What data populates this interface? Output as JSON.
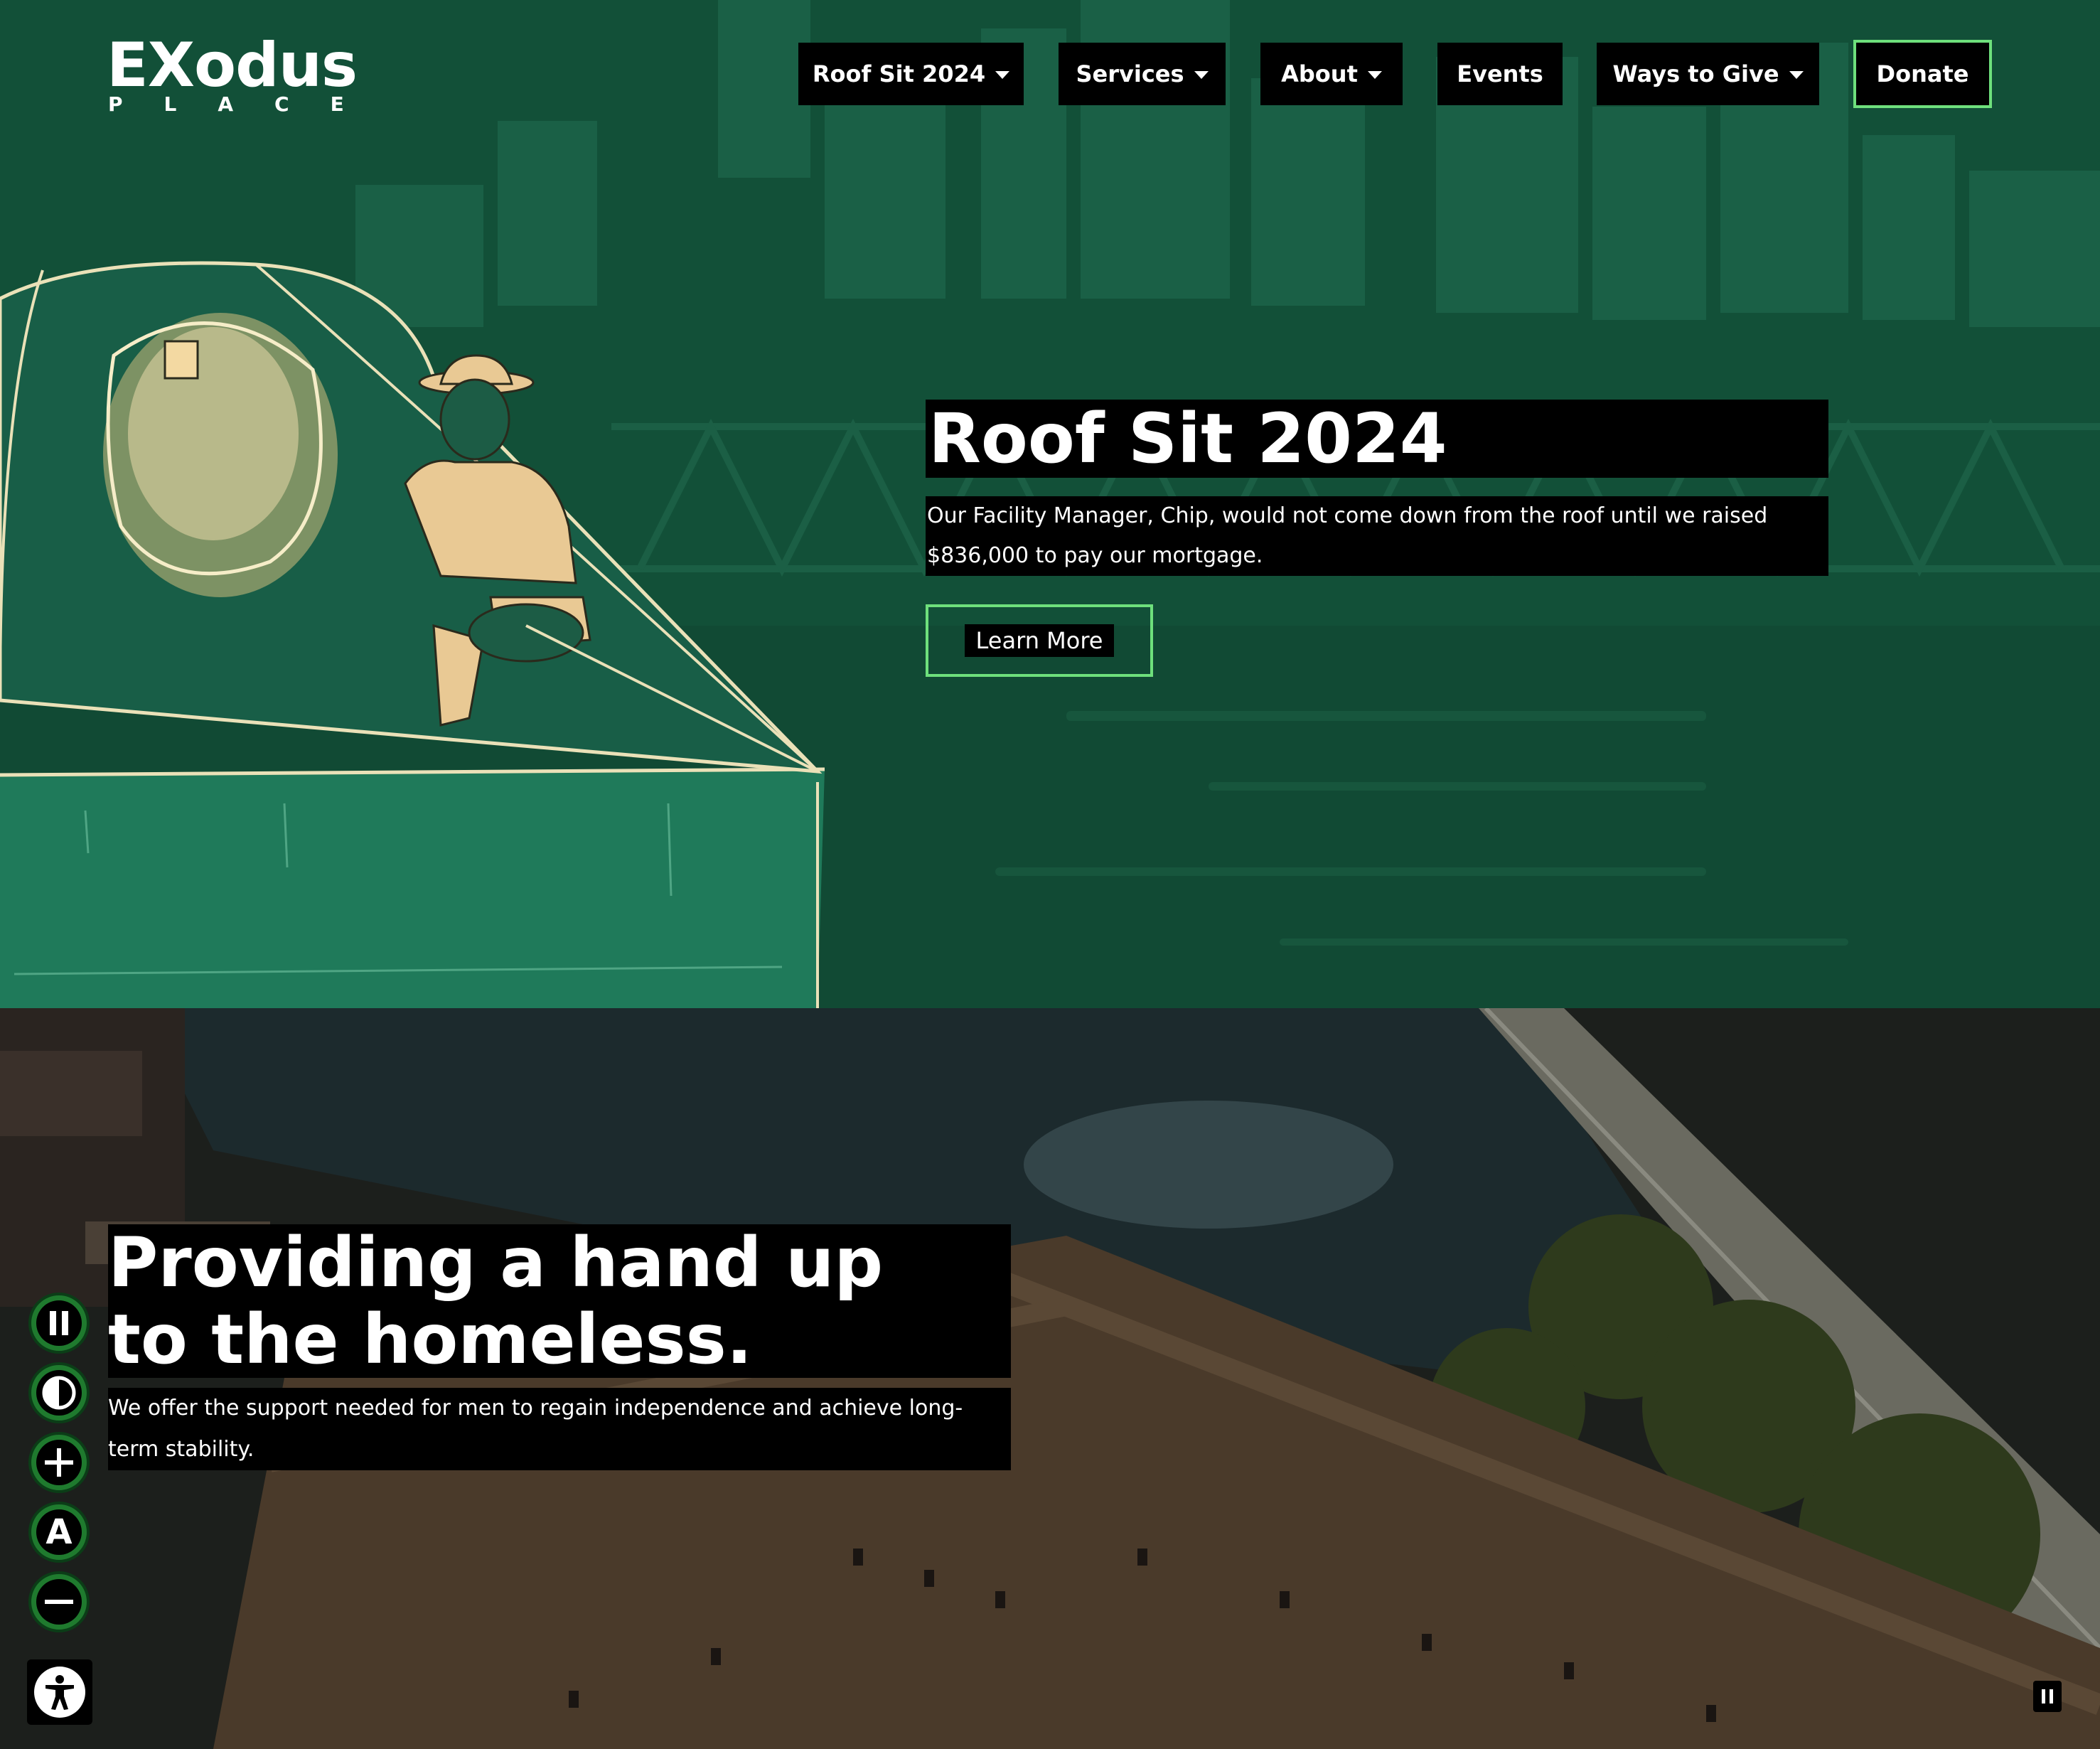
{
  "header": {
    "logo": {
      "word": "EXodus",
      "sub": "PLACE"
    },
    "nav": [
      {
        "label": "Roof Sit 2024",
        "dropdown": true
      },
      {
        "label": "Services",
        "dropdown": true
      },
      {
        "label": "About",
        "dropdown": true
      },
      {
        "label": "Events",
        "dropdown": false
      },
      {
        "label": "Ways to Give",
        "dropdown": true
      }
    ],
    "donate_label": "Donate"
  },
  "hero": {
    "title": "Roof Sit 2024",
    "description": "Our Facility Manager, Chip, would not come down from the roof until we raised $836,000 to pay our mortgage.",
    "cta_label": "Learn More"
  },
  "lower": {
    "title_line1": "Providing a hand up",
    "title_line2": "to the homeless.",
    "description": "We offer the support needed for men to regain independence and achieve long-term stability."
  },
  "accessibility": {
    "buttons": [
      "pause-animations-icon",
      "contrast-icon",
      "zoom-in-icon",
      "readable-font-icon",
      "zoom-out-icon"
    ],
    "a_glyph": "A",
    "main_icon": "accessibility-icon"
  },
  "colors": {
    "hero_bg": "#125038",
    "accent_green": "#6ee07c",
    "button_bg": "#000000",
    "a11y_green": "#1f7a2e"
  }
}
